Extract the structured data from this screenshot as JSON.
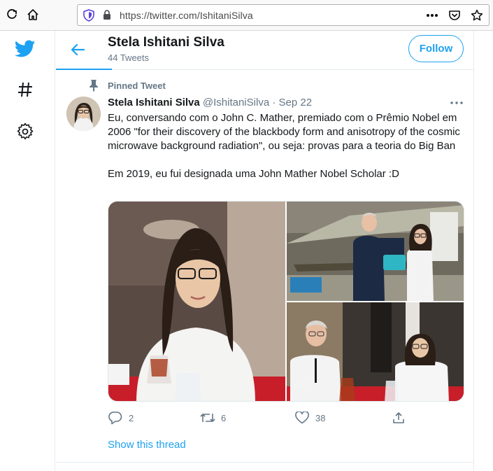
{
  "browser": {
    "url": "https://twitter.com/IshitaniSilva"
  },
  "rail": {
    "icons": [
      "twitter-logo",
      "hashtag-icon",
      "gear-icon"
    ]
  },
  "profile_header": {
    "name": "Stela Ishitani Silva",
    "tweet_count": "44 Tweets",
    "follow_label": "Follow"
  },
  "tweet": {
    "pinned_label": "Pinned Tweet",
    "display_name": "Stela Ishitani Silva",
    "handle": "@IshitaniSilva",
    "separator": "·",
    "date": "Sep 22",
    "text": "Eu, conversando com o John C. Mather, premiado com o Prêmio Nobel em 2006 \"for their discovery of the blackbody form and anisotropy of the cosmic microwave background radiation\", ou seja: provas para a teoria do Big Ban\n\nEm 2019, eu fui designada uma John Mather Nobel Scholar :D",
    "replies": "2",
    "retweets": "6",
    "likes": "38",
    "show_thread": "Show this thread"
  },
  "colors": {
    "accent": "#1da1f2",
    "secondary_text": "#657786",
    "border": "#e6ecf0"
  }
}
